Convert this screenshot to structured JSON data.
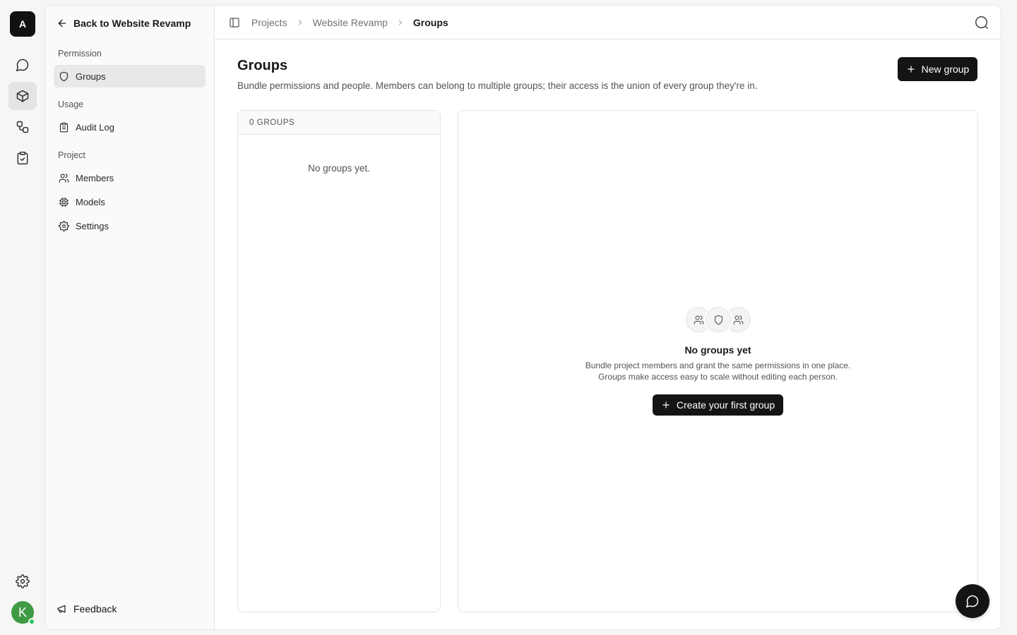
{
  "app": {
    "workspace_initial": "A",
    "user_initial": "K",
    "colors": {
      "avatar": "#3f9a45",
      "presence": "#22c55e",
      "primary_button": "#141414"
    }
  },
  "rail": {
    "items": [
      {
        "icon": "chat-bubble-icon"
      },
      {
        "icon": "cube-icon",
        "active": true
      },
      {
        "icon": "workflow-icon"
      },
      {
        "icon": "clipboard-check-icon"
      }
    ],
    "settings_icon": "gear-icon"
  },
  "sidebar": {
    "back_label": "Back to Website Revamp",
    "sections": [
      {
        "label": "Permission",
        "items": [
          {
            "label": "Groups",
            "icon": "shield-icon",
            "active": true
          }
        ]
      },
      {
        "label": "Usage",
        "items": [
          {
            "label": "Audit Log",
            "icon": "clipboard-list-icon"
          }
        ]
      },
      {
        "label": "Project",
        "items": [
          {
            "label": "Members",
            "icon": "users-icon"
          },
          {
            "label": "Models",
            "icon": "chip-icon"
          },
          {
            "label": "Settings",
            "icon": "gear-icon"
          }
        ]
      }
    ],
    "feedback_label": "Feedback"
  },
  "header": {
    "breadcrumbs": [
      "Projects",
      "Website Revamp",
      "Groups"
    ]
  },
  "main": {
    "title": "Groups",
    "subtitle": "Bundle permissions and people. Members can belong to multiple groups; their access is the union of every group they're in.",
    "new_group_label": "New group",
    "list": {
      "count_label": "0 GROUPS",
      "empty_text": "No groups yet."
    },
    "empty_state": {
      "title": "No groups yet",
      "line1": "Bundle project members and grant the same permissions in one place.",
      "line2": "Groups make access easy to scale without editing each person.",
      "cta_label": "Create your first group"
    }
  }
}
